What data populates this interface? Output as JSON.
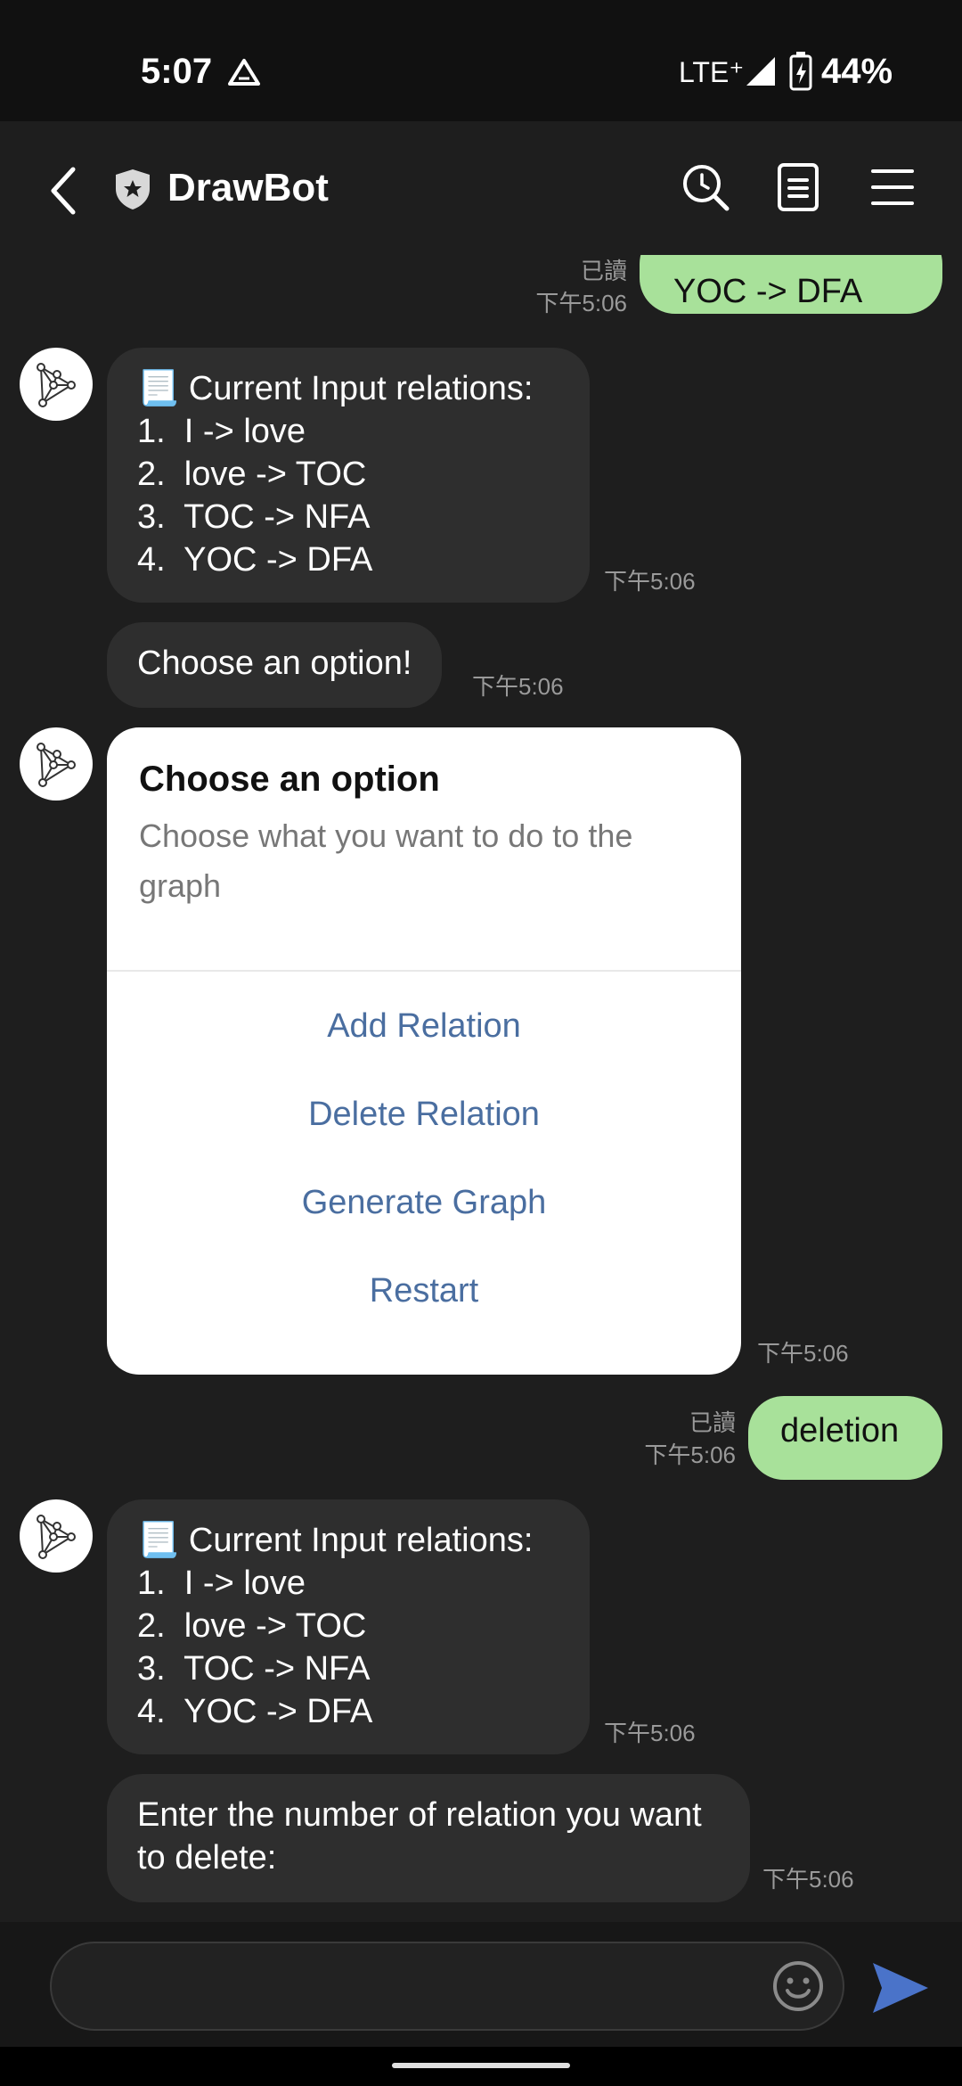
{
  "status_bar": {
    "time": "5:07",
    "network": "LTE⁺",
    "battery": "44%"
  },
  "header": {
    "title": "DrawBot"
  },
  "messages": {
    "top_out": {
      "text": "YOC -> DFA",
      "read": "已讀",
      "time": "下午5:06"
    },
    "relations_1": {
      "heading": "📃 Current Input relations:",
      "items": [
        "1.  I -> love",
        "2.  love -> TOC",
        "3.  TOC -> NFA",
        "4.  YOC -> DFA"
      ],
      "time": "下午5:06"
    },
    "choose_msg": {
      "text": "Choose an option!",
      "time": "下午5:06"
    },
    "card": {
      "title": "Choose an option",
      "subtitle": "Choose what you want to do to the graph",
      "buttons": [
        "Add Relation",
        "Delete Relation",
        "Generate Graph",
        "Restart"
      ],
      "time": "下午5:06"
    },
    "deletion_out": {
      "text": "deletion",
      "read": "已讀",
      "time": "下午5:06"
    },
    "relations_2": {
      "heading": "📃 Current Input relations:",
      "items": [
        "1.  I -> love",
        "2.  love -> TOC",
        "3.  TOC -> NFA",
        "4.  YOC -> DFA"
      ],
      "time": "下午5:06"
    },
    "enter_msg": {
      "text": "Enter the number of relation you want to delete:",
      "time": "下午5:06"
    }
  },
  "colors": {
    "outgoing_bubble": "#a8e19a",
    "incoming_bubble": "#2e2e2e",
    "card_button": "#4a6ea0",
    "send_icon": "#4a73c9"
  },
  "icons": [
    "back-icon",
    "shield-icon",
    "search-icon",
    "note-icon",
    "menu-icon",
    "emoji-icon",
    "send-icon",
    "bot-avatar-icon"
  ]
}
